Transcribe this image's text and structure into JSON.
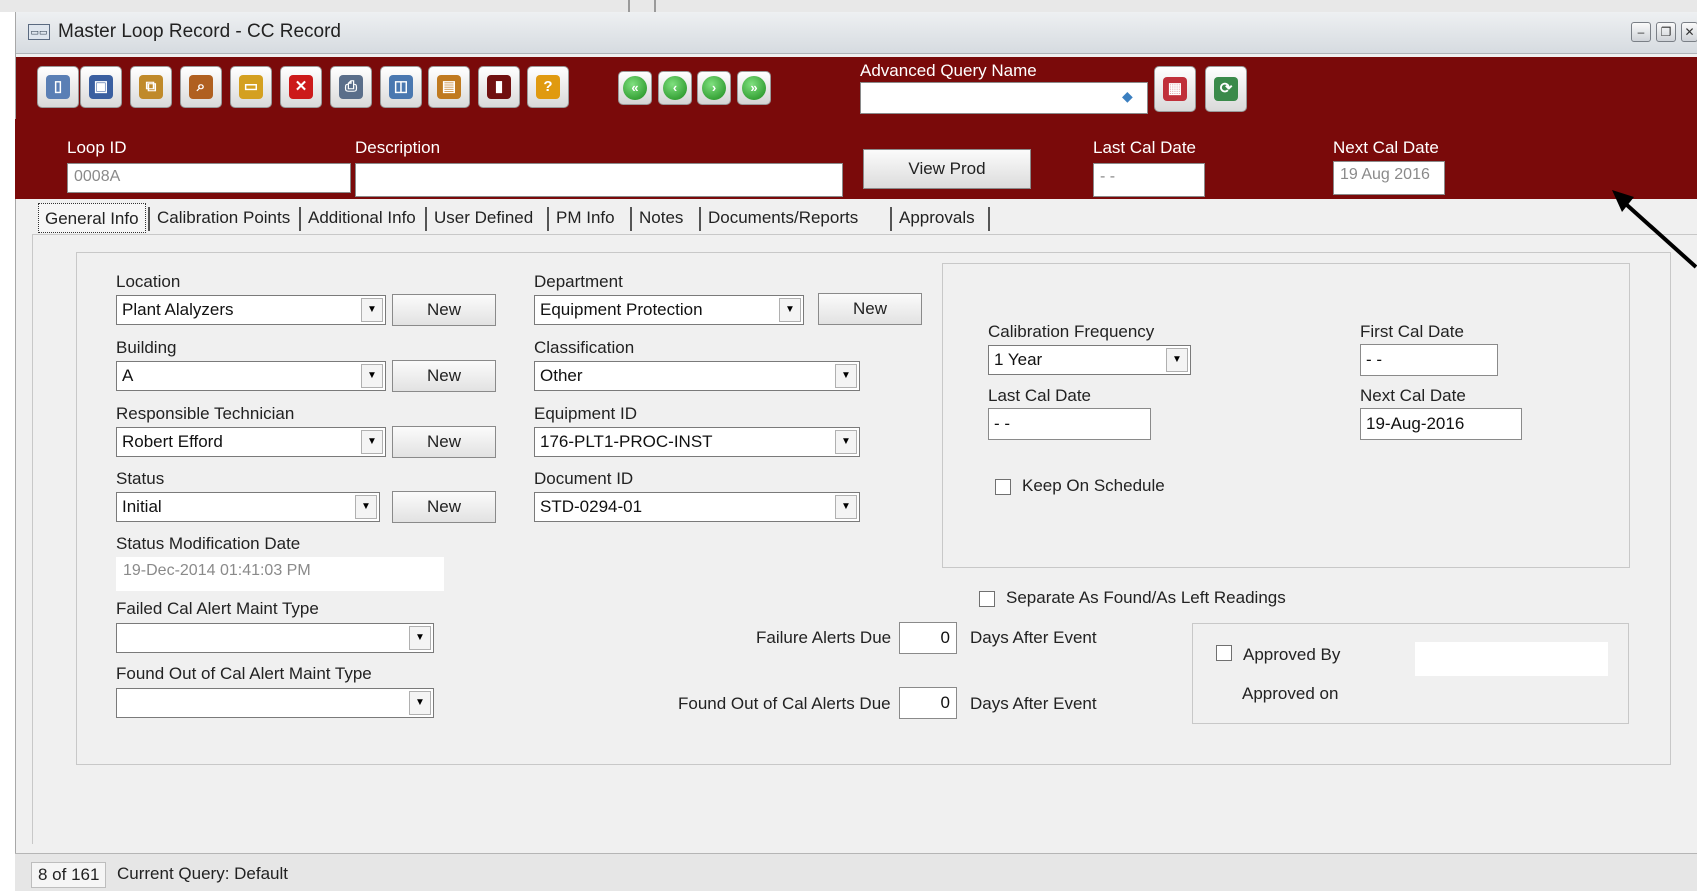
{
  "window": {
    "title": "Master Loop Record - CC Record",
    "app_icon": "app-icon"
  },
  "toolbar": {
    "buttons": [
      {
        "icon": "new-document-icon",
        "color": "#5a7fb5"
      },
      {
        "icon": "save-icon",
        "color": "#3a5fa0"
      },
      {
        "icon": "copy-record-icon",
        "color": "#c08a2a"
      },
      {
        "icon": "search-icon",
        "color": "#b06020"
      },
      {
        "icon": "open-folder-icon",
        "color": "#d4a020"
      },
      {
        "icon": "delete-icon",
        "color": "#cc1a1a"
      },
      {
        "icon": "print-icon",
        "color": "#5a6e8a"
      },
      {
        "icon": "print-preview-icon",
        "color": "#4a78b0"
      },
      {
        "icon": "report-icon",
        "color": "#c07a20"
      },
      {
        "icon": "exit-icon",
        "color": "#701010"
      },
      {
        "icon": "help-icon",
        "color": "#e09a10"
      }
    ],
    "nav_buttons": [
      "first-record-icon",
      "previous-record-icon",
      "next-record-icon",
      "last-record-icon"
    ],
    "nav_glyphs": [
      "«",
      "‹",
      "›",
      "»"
    ],
    "glyphs": [
      "▯",
      "▣",
      "⧉",
      "⌕",
      "▭",
      "✕",
      "⎙",
      "◫",
      "▤",
      "▮",
      "?"
    ],
    "advanced_query_label": "Advanced Query Name",
    "advanced_query_value": "",
    "query_button_icons": [
      "query-report-icon",
      "query-run-icon"
    ]
  },
  "header": {
    "loop_id_label": "Loop ID",
    "loop_id_value": "0008A",
    "description_label": "Description",
    "description_value": "",
    "view_prod_label": "View Prod",
    "last_cal_date_label": "Last Cal Date",
    "last_cal_date_value": "- -",
    "next_cal_date_label": "Next Cal Date",
    "next_cal_date_value": "19 Aug 2016"
  },
  "tabs": [
    "General Info",
    "Calibration Points",
    "Additional Info",
    "User Defined",
    "PM Info",
    "Notes",
    "Documents/Reports",
    "Approvals"
  ],
  "general": {
    "location_label": "Location",
    "location_value": "Plant Alalyzers",
    "building_label": "Building",
    "building_value": "A",
    "technician_label": "Responsible Technician",
    "technician_value": "Robert Efford",
    "status_label": "Status",
    "status_value": "Initial",
    "new_label": "New",
    "status_mod_label": "Status Modification Date",
    "status_mod_value": "19-Dec-2014 01:41:03 PM",
    "failed_alert_label": "Failed Cal Alert Maint Type",
    "failed_alert_value": "",
    "found_out_label": "Found Out of Cal Alert Maint Type",
    "found_out_value": "",
    "department_label": "Department",
    "department_value": "Equipment Protection",
    "classification_label": "Classification",
    "classification_value": "Other",
    "equipment_label": "Equipment ID",
    "equipment_value": "176-PLT1-PROC-INST",
    "document_label": "Document ID",
    "document_value": "STD-0294-01"
  },
  "calibration": {
    "frequency_label": "Calibration Frequency",
    "frequency_value": "1 Year",
    "first_cal_label": "First Cal Date",
    "first_cal_value": "- -",
    "last_cal_label": "Last Cal Date",
    "last_cal_value": "- -",
    "next_cal_label": "Next Cal Date",
    "next_cal_value": "19-Aug-2016",
    "keep_schedule_label": "Keep On Schedule",
    "separate_label": "Separate As Found/As Left Readings"
  },
  "alerts": {
    "failure_label": "Failure Alerts Due",
    "failure_value": "0",
    "failure_suffix": "Days After Event",
    "found_out_label": "Found Out of Cal Alerts Due",
    "found_out_value": "0",
    "found_out_suffix": "Days After Event"
  },
  "approval": {
    "approved_by_label": "Approved By",
    "approved_by_value": "",
    "approved_on_label": "Approved on"
  },
  "status": {
    "record_position": "8 of 161",
    "current_query": "Current Query: Default"
  },
  "colors": {
    "brand_red": "#7a0a0a"
  }
}
